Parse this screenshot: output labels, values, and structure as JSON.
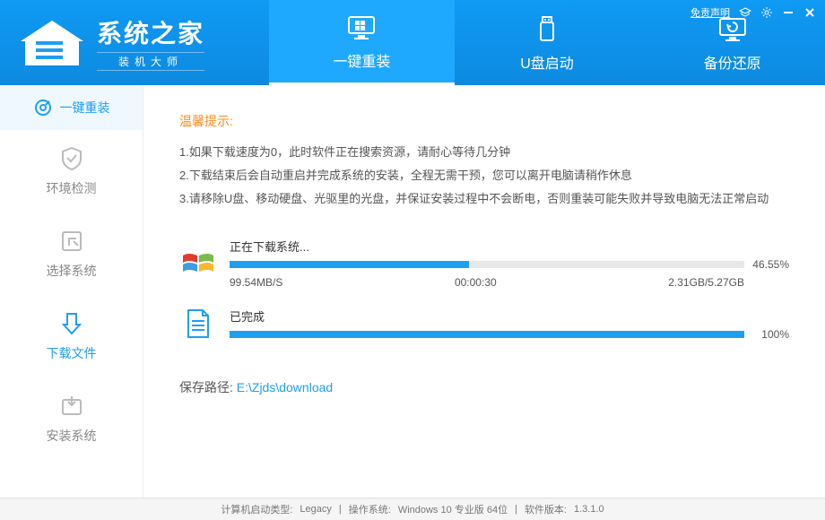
{
  "header": {
    "logo_title": "系统之家",
    "logo_subtitle": "装机大师",
    "disclaimer": "免责声明"
  },
  "nav": {
    "reinstall": "一键重装",
    "usb_boot": "U盘启动",
    "backup": "备份还原"
  },
  "sidebar": {
    "reinstall": "一键重装",
    "env_check": "环境检测",
    "select_sys": "选择系统",
    "download": "下载文件",
    "install": "安装系统"
  },
  "tips": {
    "title": "温馨提示:",
    "line1": "1.如果下载速度为0，此时软件正在搜索资源，请耐心等待几分钟",
    "line2": "2.下载结束后会自动重启并完成系统的安装，全程无需干预，您可以离开电脑请稍作休息",
    "line3": "3.请移除U盘、移动硬盘、光驱里的光盘，并保证安装过程中不会断电，否则重装可能失败并导致电脑无法正常启动"
  },
  "download_progress": {
    "label": "正在下载系统...",
    "percent": "46.55%",
    "percent_val": 46.55,
    "speed": "99.54MB/S",
    "elapsed": "00:00:30",
    "size": "2.31GB/5.27GB"
  },
  "complete_progress": {
    "label": "已完成",
    "percent": "100%",
    "percent_val": 100
  },
  "save_path": {
    "label": "保存路径:",
    "value": "E:\\Zjds\\download"
  },
  "footer": {
    "boot_type_label": "计算机启动类型:",
    "boot_type": "Legacy",
    "os_label": "操作系统:",
    "os": "Windows 10 专业版 64位",
    "ver_label": "软件版本:",
    "ver": "1.3.1.0"
  }
}
